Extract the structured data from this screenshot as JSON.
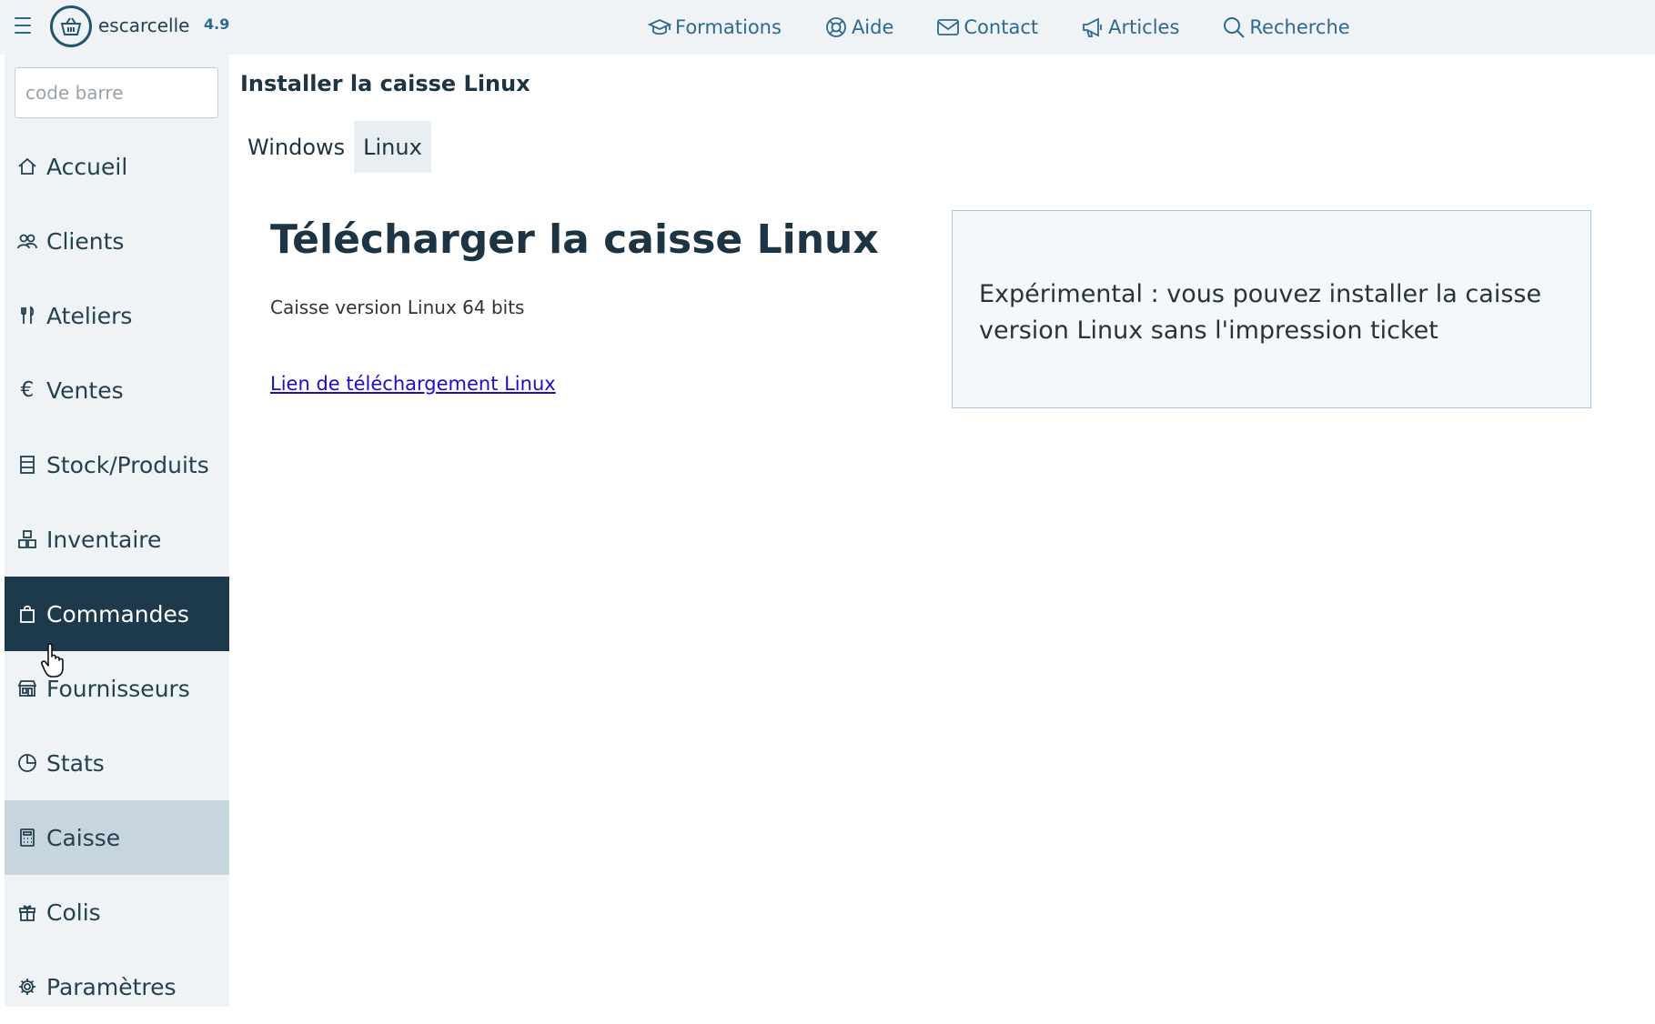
{
  "topbar": {
    "brand": "escarcelle",
    "version": "4.9",
    "nav": [
      {
        "label": "Formations",
        "icon": "graduation-cap-icon"
      },
      {
        "label": "Aide",
        "icon": "lifebuoy-icon"
      },
      {
        "label": "Contact",
        "icon": "envelope-icon"
      },
      {
        "label": "Articles",
        "icon": "megaphone-icon"
      },
      {
        "label": "Recherche",
        "icon": "search-icon"
      }
    ]
  },
  "sidebar": {
    "barcode_placeholder": "code barre",
    "items": [
      {
        "label": "Accueil",
        "icon": "home-icon"
      },
      {
        "label": "Clients",
        "icon": "people-icon"
      },
      {
        "label": "Ateliers",
        "icon": "utensils-icon"
      },
      {
        "label": "Ventes",
        "icon": "euro-icon"
      },
      {
        "label": "Stock/Produits",
        "icon": "stock-icon"
      },
      {
        "label": "Inventaire",
        "icon": "boxes-icon"
      },
      {
        "label": "Commandes",
        "icon": "shopping-bag-icon",
        "state": "hover"
      },
      {
        "label": "Fournisseurs",
        "icon": "shop-icon"
      },
      {
        "label": "Stats",
        "icon": "pie-chart-icon"
      },
      {
        "label": "Caisse",
        "icon": "calculator-icon",
        "state": "active"
      },
      {
        "label": "Colis",
        "icon": "gift-icon"
      },
      {
        "label": "Paramètres",
        "icon": "gear-icon"
      }
    ]
  },
  "main": {
    "page_title": "Installer la caisse Linux",
    "tabs": [
      {
        "label": "Windows",
        "selected": false
      },
      {
        "label": "Linux",
        "selected": true
      }
    ],
    "download_title": "Télécharger la caisse Linux",
    "download_subtitle": "Caisse version Linux 64 bits",
    "download_link": "Lien de téléchargement Linux",
    "info_text": "Expérimental : vous pouvez installer la caisse version Linux sans l'impression ticket"
  },
  "colors": {
    "accent": "#2c6a8f",
    "sidebar_bg": "#eff3f6",
    "active_dark": "#1d3a4c",
    "active_light": "#c7d5de",
    "link": "#1a0dcc"
  }
}
